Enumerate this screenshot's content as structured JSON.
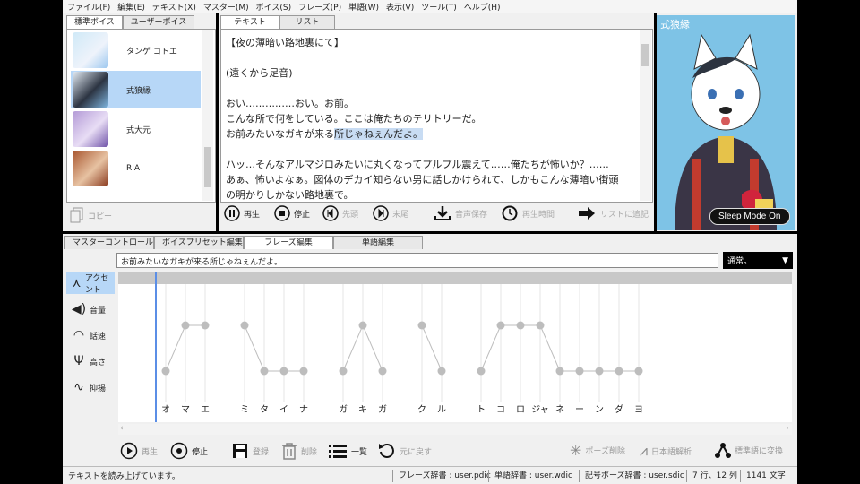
{
  "menu": [
    "ファイル(F)",
    "編集(E)",
    "テキスト(X)",
    "マスター(M)",
    "ボイス(S)",
    "フレーズ(P)",
    "単語(W)",
    "表示(V)",
    "ツール(T)",
    "ヘルプ(H)"
  ],
  "voice_tabs": [
    "標準ボイス",
    "ユーザーボイス"
  ],
  "voices": [
    {
      "name": "タンゲ コトエ",
      "selected": false
    },
    {
      "name": "式狼縁",
      "selected": true
    },
    {
      "name": "式大元",
      "selected": false
    },
    {
      "name": "RIA",
      "selected": false
    }
  ],
  "copy_label": "コピー",
  "text_tabs": [
    "テキスト",
    "リスト"
  ],
  "text_lines": [
    {
      "pre": "【夜の薄暗い路地裏にて】",
      "hl": "",
      "post": ""
    },
    {
      "pre": "",
      "hl": "",
      "post": ""
    },
    {
      "pre": "(遠くから足音)",
      "hl": "",
      "post": ""
    },
    {
      "pre": "",
      "hl": "",
      "post": ""
    },
    {
      "pre": "おい……………おい。お前。",
      "hl": "",
      "post": ""
    },
    {
      "pre": "こんな所で何をしている。ここは俺たちのテリトリーだ。",
      "hl": "",
      "post": ""
    },
    {
      "pre": "お前みたいなガキが来る",
      "hl": "所じゃねぇんだよ。",
      "post": ""
    },
    {
      "pre": "",
      "hl": "",
      "post": ""
    },
    {
      "pre": "ハッ…そんなアルマジロみたいに丸くなってプルプル震えて……俺たちが怖いか？……",
      "hl": "",
      "post": ""
    },
    {
      "pre": "あぁ、怖いよなぁ。図体のデカイ知らない男に話しかけられて、しかもこんな薄暗い街頭",
      "hl": "",
      "post": ""
    },
    {
      "pre": "の明かりしかない路地裏で。",
      "hl": "",
      "post": ""
    }
  ],
  "playback": {
    "play": "再生",
    "stop": "停止",
    "head": "先頭",
    "tail": "末尾",
    "save": "音声保存",
    "time": "再生時間",
    "list_add": "リストに追記"
  },
  "character": {
    "name": "式狼縁",
    "sleep_mode": "Sleep Mode On"
  },
  "bottom_tabs": [
    "マスターコントロール",
    "ボイスプリセット編集",
    "フレーズ編集",
    "単語編集"
  ],
  "phrase_text": "お前みたいなガキが来る所じゃねぇんだよ。",
  "style_select": "通常。",
  "side_buttons": [
    {
      "label": "アクセント",
      "icon": "accent-icon",
      "selected": true
    },
    {
      "label": "音量",
      "icon": "volume-icon",
      "selected": false
    },
    {
      "label": "話速",
      "icon": "speed-icon",
      "selected": false
    },
    {
      "label": "高さ",
      "icon": "pitch-icon",
      "selected": false
    },
    {
      "label": "抑揚",
      "icon": "intonation-icon",
      "selected": false
    }
  ],
  "accent_moras": [
    {
      "kana": "オ",
      "high": false
    },
    {
      "kana": "マ",
      "high": true
    },
    {
      "kana": "エ",
      "high": true
    },
    {
      "kana": "ミ",
      "high": true
    },
    {
      "kana": "タ",
      "high": false
    },
    {
      "kana": "イ",
      "high": false
    },
    {
      "kana": "ナ",
      "high": false
    },
    {
      "kana": "ガ",
      "high": false
    },
    {
      "kana": "キ",
      "high": true
    },
    {
      "kana": "ガ",
      "high": false
    },
    {
      "kana": "ク",
      "high": true
    },
    {
      "kana": "ル",
      "high": false
    },
    {
      "kana": "ト",
      "high": false
    },
    {
      "kana": "コ",
      "high": true
    },
    {
      "kana": "ロ",
      "high": true
    },
    {
      "kana": "ジャ",
      "high": true
    },
    {
      "kana": "ネ",
      "high": false
    },
    {
      "kana": "ー",
      "high": false
    },
    {
      "kana": "ン",
      "high": false
    },
    {
      "kana": "ダ",
      "high": false
    },
    {
      "kana": "ヨ",
      "high": false
    }
  ],
  "accent_groups": [
    [
      0,
      1,
      2
    ],
    [
      3,
      4,
      5,
      6
    ],
    [
      7,
      8,
      9
    ],
    [
      10,
      11
    ],
    [
      12,
      13,
      14,
      15,
      16,
      17,
      18,
      19,
      20
    ]
  ],
  "bottom_buttons": {
    "play": "再生",
    "stop": "停止",
    "register": "登録",
    "delete": "削除",
    "list": "一覧",
    "undo": "元に戻す",
    "pause_delete": "ポーズ削除",
    "jp_analysis": "日本語解析",
    "std_convert": "標準語に変換"
  },
  "status": {
    "message": "テキストを読み上げています。",
    "phrase_dict": "フレーズ辞書 : user.pdic",
    "word_dict": "単語辞書 : user.wdic",
    "symbol_dict": "記号ポーズ辞書 : user.sdic",
    "position": "7 行、12 列",
    "chars": "1141 文字"
  },
  "colors": {
    "selection": "#b7d7f7",
    "text_highlight": "#c8dcf3",
    "cursor_line": "#5b8ee6"
  }
}
